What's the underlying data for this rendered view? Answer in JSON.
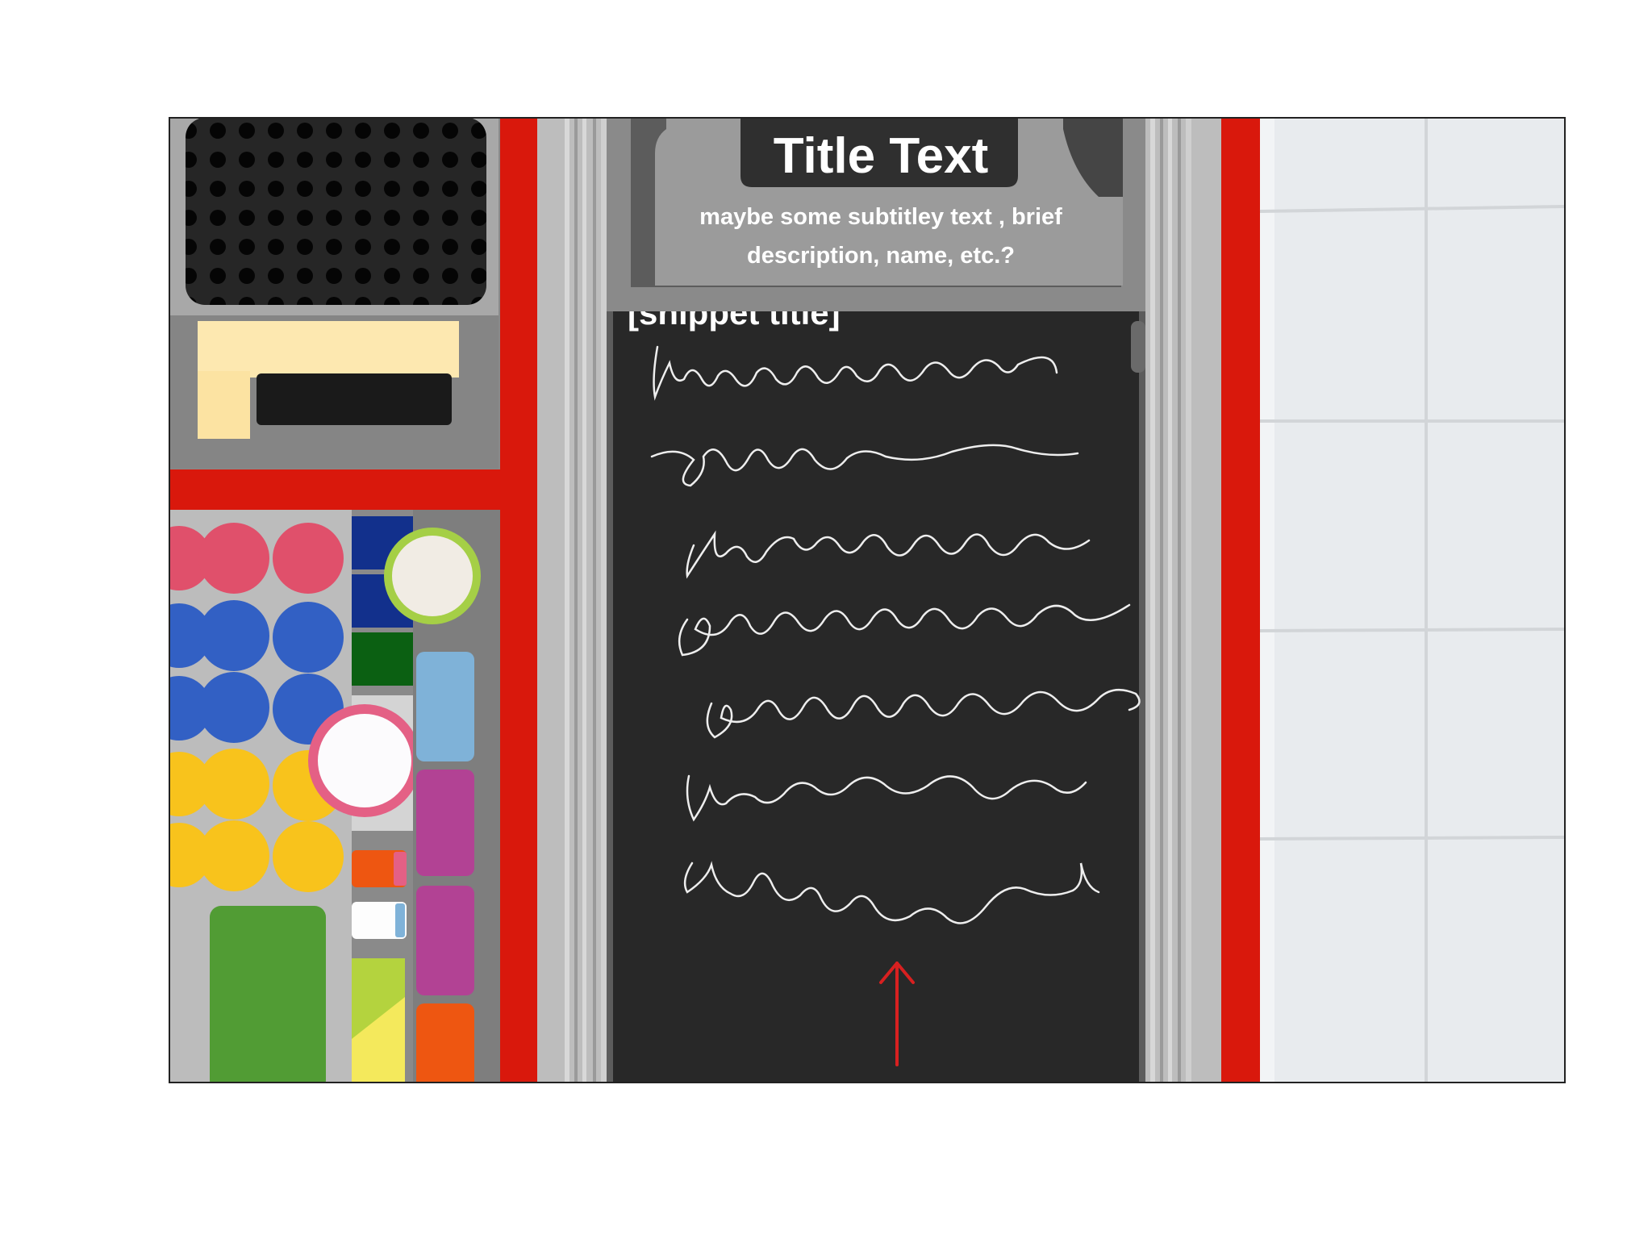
{
  "header": {
    "title": "Title Text",
    "subtitle_line1": "maybe some subtitley text , brief",
    "subtitle_line2": "description, name, etc.?"
  },
  "panel": {
    "snippet_title": "[snippet title]"
  },
  "colors": {
    "rail_red": "#d9180c",
    "panel_dark": "#282828",
    "frame_gray": "#8a8a8a",
    "tile_light": "#e8ebee",
    "arrow_red": "#d82020"
  },
  "icons": {
    "scroll_hint": "up-arrow-icon"
  }
}
